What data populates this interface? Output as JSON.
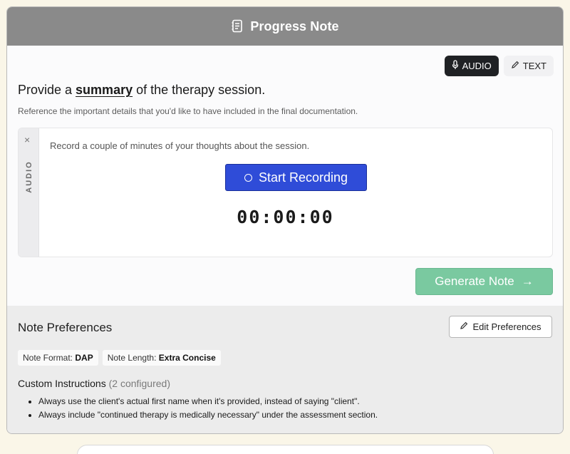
{
  "header": {
    "title": "Progress Note",
    "icon": "note-icon"
  },
  "mode_toggle": {
    "audio_label": "AUDIO",
    "text_label": "TEXT",
    "selected": "AUDIO"
  },
  "prompt": {
    "heading_prefix": "Provide a ",
    "heading_emphasis": "summary",
    "heading_suffix": " of the therapy session.",
    "subtext": "Reference the important details that you'd like to have included in the final documentation."
  },
  "audio": {
    "rail_label": "AUDIO",
    "close_glyph": "×",
    "instruction": "Record a couple of minutes of your thoughts about the session.",
    "record_label": "Start Recording",
    "timer": "00:00:00"
  },
  "generate": {
    "label": "Generate Note",
    "arrow": "→"
  },
  "preferences": {
    "title": "Note Preferences",
    "edit_label": "Edit Preferences",
    "format_label": "Note Format:",
    "format_value": "DAP",
    "length_label": "Note Length:",
    "length_value": "Extra Concise",
    "custom_title": "Custom Instructions",
    "custom_count": "(2 configured)",
    "instructions": [
      "Always use the client's actual first name when it's provided, instead of saying \"client\".",
      "Always include \"continued therapy is medically necessary\" under the assessment section."
    ]
  },
  "colors": {
    "header_bg": "#8a8a8a",
    "record_blue": "#2f4cd8",
    "generate_green": "#7ac9a0"
  }
}
